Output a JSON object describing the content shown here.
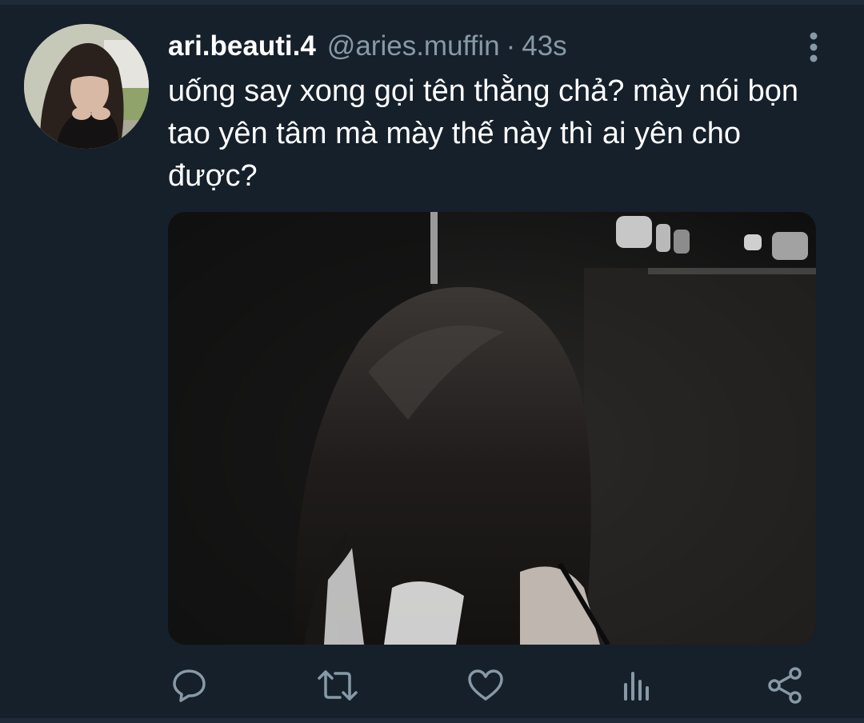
{
  "tweet": {
    "display_name": "ari.beauti.4",
    "handle": "@aries.muffin",
    "separator": "·",
    "timestamp": "43s",
    "text": "uống say xong gọi tên thằng chả? mày nói bọn tao yên tâm mà mày thế này thì ai yên cho được?",
    "avatar_icon": "user-avatar-photo",
    "media_icon": "photo-girl-back-of-head-night"
  },
  "actions": [
    {
      "name": "reply",
      "icon": "reply-bubble-icon"
    },
    {
      "name": "retweet",
      "icon": "retweet-icon"
    },
    {
      "name": "like",
      "icon": "heart-icon"
    },
    {
      "name": "analytics",
      "icon": "bar-chart-icon"
    },
    {
      "name": "share",
      "icon": "share-icon"
    }
  ],
  "colors": {
    "background": "#15202b",
    "primary_text": "#ffffff",
    "secondary_text": "#8899a6"
  }
}
